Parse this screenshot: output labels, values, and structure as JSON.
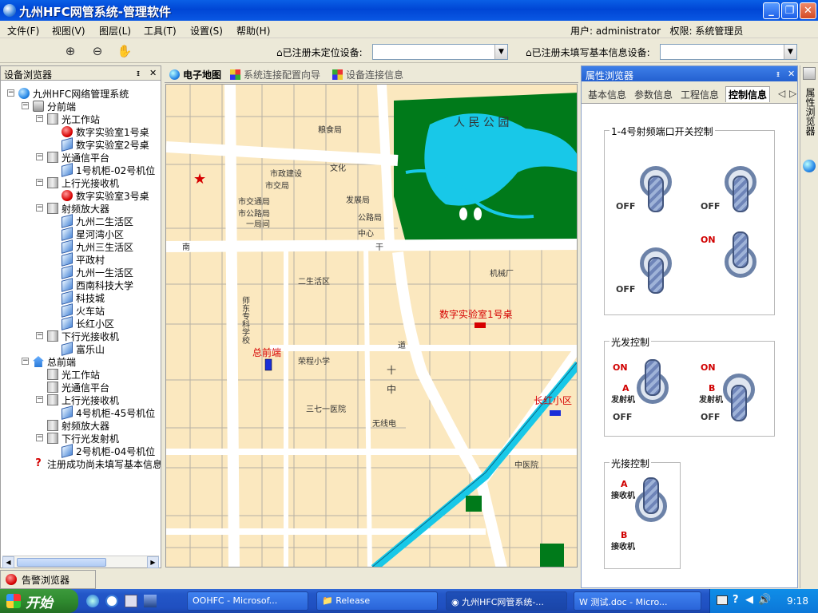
{
  "window": {
    "title": "九州HFC网管系统-管理软件"
  },
  "menu": {
    "items": [
      "文件(F)",
      "视图(V)",
      "图层(L)",
      "工具(T)",
      "设置(S)",
      "帮助(H)"
    ]
  },
  "user": {
    "label": "用户: administrator",
    "role": "权限: 系统管理员"
  },
  "toolbar": {
    "unlocated_label": "已注册未定位设备:",
    "unfilled_label": "已注册未填写基本信息设备:",
    "unlocated_value": "",
    "unfilled_value": ""
  },
  "device_browser": {
    "title": "设备浏览器",
    "tree": [
      {
        "label": "九州HFC网络管理系统",
        "icon": "system",
        "level": 0
      },
      {
        "label": "分前端",
        "icon": "group",
        "level": 1
      },
      {
        "label": "光工作站",
        "icon": "building",
        "level": 2
      },
      {
        "label": "数字实验室1号桌",
        "icon": "alarm",
        "level": 3
      },
      {
        "label": "数字实验室2号桌",
        "icon": "device",
        "level": 3
      },
      {
        "label": "光通信平台",
        "icon": "building",
        "level": 2
      },
      {
        "label": "1号机柜-02号机位",
        "icon": "device",
        "level": 3
      },
      {
        "label": "上行光接收机",
        "icon": "building",
        "level": 2
      },
      {
        "label": "数字实验室3号桌",
        "icon": "alarm",
        "level": 3
      },
      {
        "label": "射频放大器",
        "icon": "building",
        "level": 2
      },
      {
        "label": "九州二生活区",
        "icon": "device",
        "level": 3
      },
      {
        "label": "星河湾小区",
        "icon": "device",
        "level": 3
      },
      {
        "label": "九州三生活区",
        "icon": "device",
        "level": 3
      },
      {
        "label": "平政村",
        "icon": "device",
        "level": 3
      },
      {
        "label": "九州一生活区",
        "icon": "device",
        "level": 3
      },
      {
        "label": "西南科技大学",
        "icon": "device",
        "level": 3
      },
      {
        "label": "科技城",
        "icon": "device",
        "level": 3
      },
      {
        "label": "火车站",
        "icon": "device",
        "level": 3
      },
      {
        "label": "长红小区",
        "icon": "device",
        "level": 3
      },
      {
        "label": "下行光接收机",
        "icon": "building",
        "level": 2
      },
      {
        "label": "富乐山",
        "icon": "device",
        "level": 3
      },
      {
        "label": "总前端",
        "icon": "house",
        "level": 1
      },
      {
        "label": "光工作站",
        "icon": "building",
        "level": 2
      },
      {
        "label": "光通信平台",
        "icon": "building",
        "level": 2
      },
      {
        "label": "上行光接收机",
        "icon": "building",
        "level": 2
      },
      {
        "label": "4号机柜-45号机位",
        "icon": "device",
        "level": 3
      },
      {
        "label": "射频放大器",
        "icon": "building",
        "level": 2
      },
      {
        "label": "下行光发射机",
        "icon": "building",
        "level": 2
      },
      {
        "label": "2号机柜-04号机位",
        "icon": "device",
        "level": 3
      },
      {
        "label": "注册成功尚未填写基本信息",
        "icon": "question",
        "level": 1
      }
    ]
  },
  "center": {
    "tabs": [
      "电子地图",
      "系统连接配置向导",
      "设备连接信息"
    ],
    "active_tab": "电子地图"
  },
  "map": {
    "markers": [
      "数字实验室1号桌",
      "总前端",
      "长红小区"
    ],
    "labels": [
      "人 民 公 园",
      "南",
      "干",
      "道",
      "十",
      "中",
      "三七一医院",
      "无线电",
      "机械厂",
      "市交通局",
      "市公路局",
      "市交局",
      "一局间",
      "市政建设",
      "文化",
      "发展局",
      "粮食局",
      "师东专科学校",
      "荣程小学",
      "中医院",
      "二生活区",
      "公路局",
      "中心"
    ]
  },
  "property_browser": {
    "title": "属性浏览器",
    "tabs": [
      "基本信息",
      "参数信息",
      "工程信息",
      "控制信息"
    ],
    "active_tab": "控制信息",
    "rf_group": {
      "title": "1-4号射频端口开关控制",
      "switches": [
        {
          "state": "OFF"
        },
        {
          "state": "OFF"
        },
        {
          "state": "OFF"
        },
        {
          "state": "ON"
        }
      ]
    },
    "optical_tx": {
      "title": "光发控制",
      "switches": [
        {
          "channel": "A",
          "device": "发射机",
          "on": "ON",
          "off": "OFF"
        },
        {
          "channel": "B",
          "device": "发射机",
          "on": "ON",
          "off": "OFF"
        }
      ]
    },
    "optical_rx": {
      "title": "光接控制",
      "switches": [
        {
          "channel": "A",
          "device": "接收机"
        },
        {
          "channel": "B",
          "device": "接收机"
        }
      ]
    }
  },
  "side_strip": {
    "label": "属性浏览器"
  },
  "alarm_browser": {
    "label": "告警浏览器"
  },
  "taskbar": {
    "start": "开始",
    "tasks": [
      "OOHFC - Microsof...",
      "Release",
      "九州HFC网管系统-...",
      "测试.doc - Micro..."
    ],
    "active_task": "九州HFC网管系统-...",
    "clock": "9:18"
  },
  "colors": {
    "map_block": "#fbe8bf",
    "road": "#ffffff",
    "park": "#007a1a",
    "water": "#18c8e8",
    "marker_red": "#d60000",
    "marker_blue": "#1a2ed8"
  }
}
